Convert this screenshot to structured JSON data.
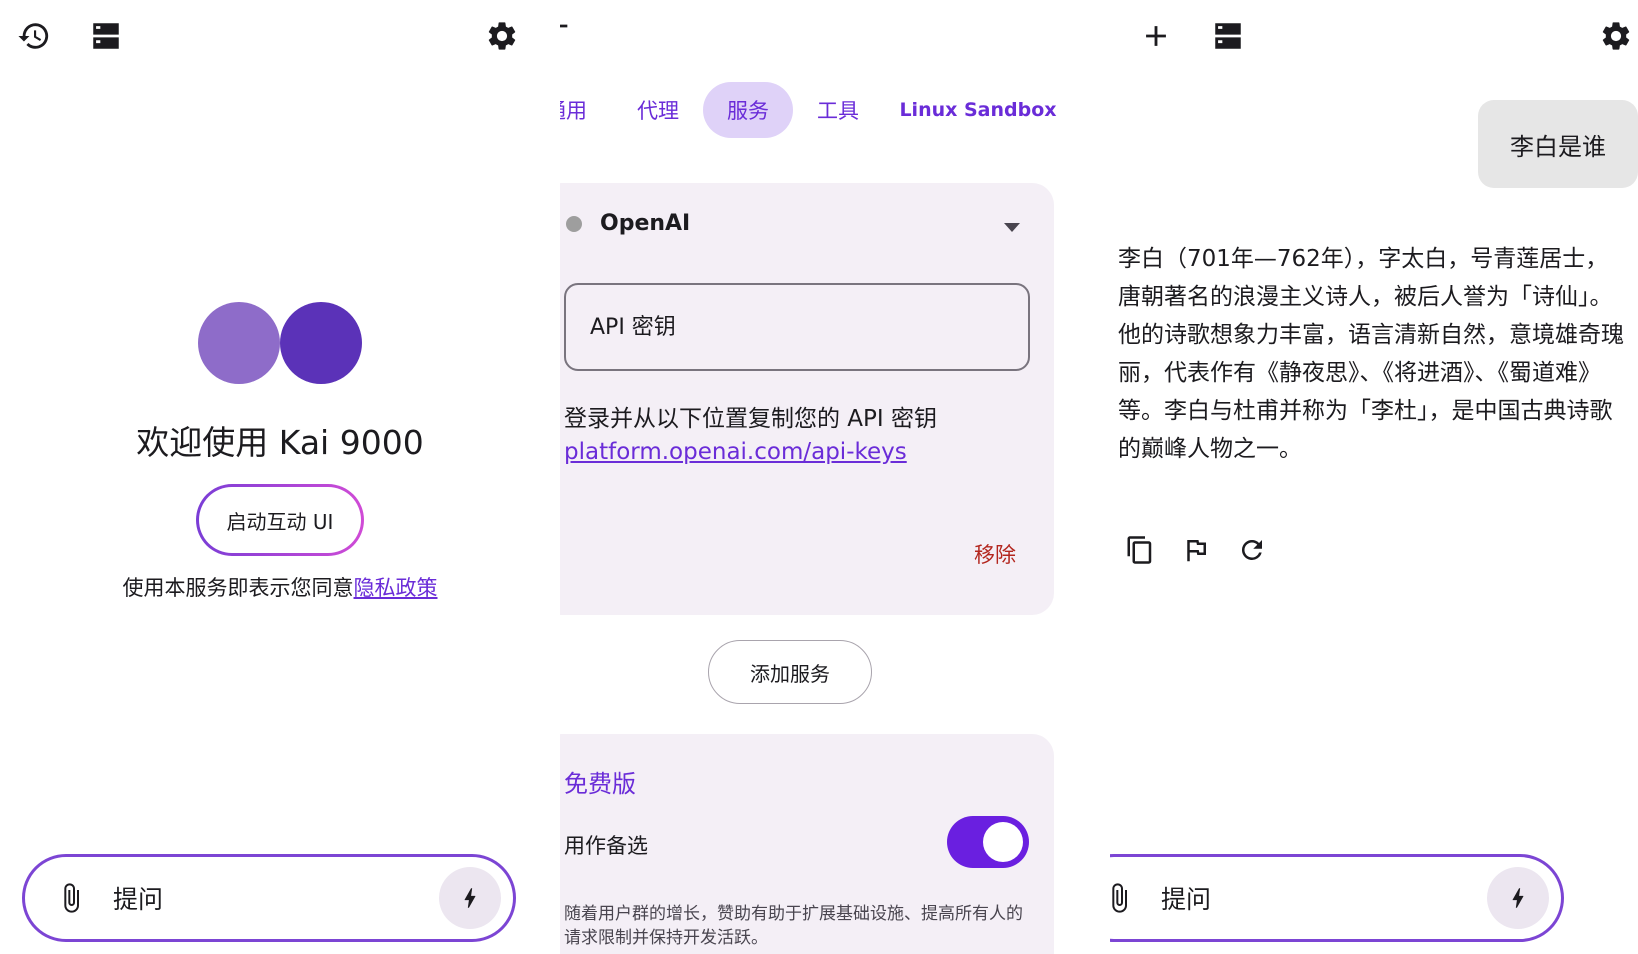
{
  "welcome_panel": {
    "welcome_text": "欢迎使用 Kai 9000",
    "launch_button": "启动互动 UI",
    "agree_text": "使用本服务即表示您同意",
    "privacy_link": "隐私政策",
    "ask_placeholder": "提问"
  },
  "settings_panel": {
    "tabs": [
      {
        "label": "通用",
        "active": false
      },
      {
        "label": "代理",
        "active": false
      },
      {
        "label": "服务",
        "active": true
      },
      {
        "label": "工具",
        "active": false
      },
      {
        "label": "Linux Sandbox",
        "active": false
      }
    ],
    "service": {
      "name": "OpenAI",
      "api_key_placeholder": "API 密钥",
      "hint": "登录并从以下位置复制您的 API 密钥",
      "link": "platform.openai.com/api-keys",
      "remove": "移除"
    },
    "add_service": "添加服务",
    "free_plan": {
      "title": "免费版",
      "backup_label": "用作备选",
      "backup_enabled": true,
      "description": "随着用户群的增长，赞助有助于扩展基础设施、提高所有人的请求限制并保持开发活跃。"
    }
  },
  "chat_panel": {
    "user_message": "李白是谁",
    "assistant_message": "李白（701年—762年），字太白，号青莲居士，唐朝著名的浪漫主义诗人，被后人誉为「诗仙」。他的诗歌想象力丰富，语言清新自然，意境雄奇瑰丽，代表作有《静夜思》、《将进酒》、《蜀道难》等。李白与杜甫并称为「李杜」，是中国古典诗歌的巅峰人物之一。",
    "ask_placeholder": "提问"
  },
  "colors": {
    "accent": "#6a2cd8",
    "logo_light": "#8e6cc9",
    "logo_dark": "#5b32b8",
    "card_bg": "#f4eff6",
    "danger": "#b3261e"
  },
  "icons": [
    "history-icon",
    "server-icon",
    "gear-icon",
    "back-arrow-icon",
    "plus-icon",
    "paperclip-icon",
    "bolt-icon",
    "copy-icon",
    "flag-icon",
    "refresh-icon"
  ]
}
